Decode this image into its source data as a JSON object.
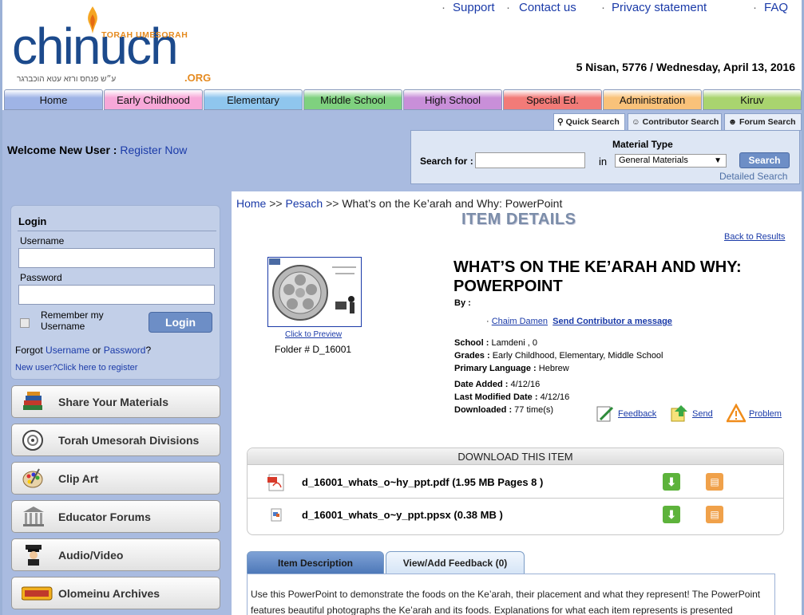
{
  "logo": {
    "text": "chinuch",
    "tagline": "TORAH UMESORAH",
    "org": ".ORG",
    "hebrew": "ע״ש פנחס ורזא עטא הוכברגר"
  },
  "top_links": [
    "Support",
    "Contact us",
    "Privacy statement",
    "FAQ"
  ],
  "date": "5 Nisan, 5776 / Wednesday, April 13, 2016",
  "nav": [
    {
      "label": "Home",
      "color": "#9fb4e6"
    },
    {
      "label": "Early Childhood",
      "color": "#f7a8d8"
    },
    {
      "label": "Elementary",
      "color": "#8fc6ee"
    },
    {
      "label": "Middle School",
      "color": "#7fd17f"
    },
    {
      "label": "High School",
      "color": "#c98fd9"
    },
    {
      "label": "Special Ed.",
      "color": "#f27b78"
    },
    {
      "label": "Administration",
      "color": "#f9c27a"
    },
    {
      "label": "Kiruv",
      "color": "#a9d46f"
    }
  ],
  "welcome": {
    "text": "Welcome New User :",
    "register": "Register Now"
  },
  "search": {
    "tabs": [
      "Quick Search",
      "Contributor Search",
      "Forum Search"
    ],
    "material_type_label": "Material Type",
    "search_for_label": "Search for :",
    "in_label": "in",
    "selected_material": "General Materials",
    "button": "Search",
    "detailed": "Detailed Search"
  },
  "login": {
    "title": "Login",
    "username_label": "Username",
    "password_label": "Password",
    "remember_line1": "Remember my",
    "remember_line2": "Username",
    "button": "Login",
    "forgot_prefix": "Forgot",
    "forgot_username": "Username",
    "forgot_or": "or",
    "forgot_password": "Password",
    "forgot_suffix": "?",
    "new_user": "New user?Click here to register"
  },
  "side_buttons": [
    {
      "label": "Share Your Materials",
      "icon": "books-icon"
    },
    {
      "label": "Torah Umesorah Divisions",
      "icon": "divisions-icon"
    },
    {
      "label": "Clip Art",
      "icon": "palette-icon"
    },
    {
      "label": "Educator Forums",
      "icon": "columns-icon"
    },
    {
      "label": "Audio/Video",
      "icon": "audio-video-icon"
    },
    {
      "label": "Olomeinu Archives",
      "icon": "olomeinu-icon"
    }
  ],
  "breadcrumb": {
    "home": "Home",
    "sep": ">>",
    "section": "Pesach",
    "current": "What’s on the Ke’arah and Why: PowerPoint"
  },
  "page_title": "ITEM DETAILS",
  "back_to_results": "Back to Results",
  "item": {
    "title": "WHAT’S ON THE KE’ARAH AND WHY: POWERPOINT",
    "click_to_preview": "Click to Preview",
    "folder": "Folder # D_16001",
    "by_label": "By :",
    "contributor": "Chaim Damen",
    "send_message": "Send Contributor a message",
    "school_label": "School :",
    "school": "Lamdeni , 0",
    "grades_label": "Grades :",
    "grades": "Early Childhood, Elementary, Middle School",
    "language_label": "Primary Language :",
    "language": "Hebrew",
    "date_added_label": "Date Added :",
    "date_added": "4/12/16",
    "modified_label": "Last Modified Date :",
    "modified": "4/12/16",
    "downloaded_label": "Downloaded :",
    "downloaded": "77 time(s)"
  },
  "actions": [
    "Feedback",
    "Send",
    "Problem"
  ],
  "download": {
    "header": "DOWNLOAD THIS ITEM",
    "files": [
      {
        "name": "d_16001_whats_o~hy_ppt.pdf (1.95 MB Pages 8 )",
        "icon": "pdf-icon"
      },
      {
        "name": "d_16001_whats_o~y_ppt.ppsx (0.38 MB )",
        "icon": "ppsx-icon"
      }
    ]
  },
  "desc_tabs": [
    "Item Description",
    "View/Add Feedback (0)"
  ],
  "description": "Use this PowerPoint to demonstrate the foods on the Ke’arah, their placement and what they represent! The PowerPoint features beautiful photographs the Ke’arah and its foods. Explanations for what each item represents is presented"
}
